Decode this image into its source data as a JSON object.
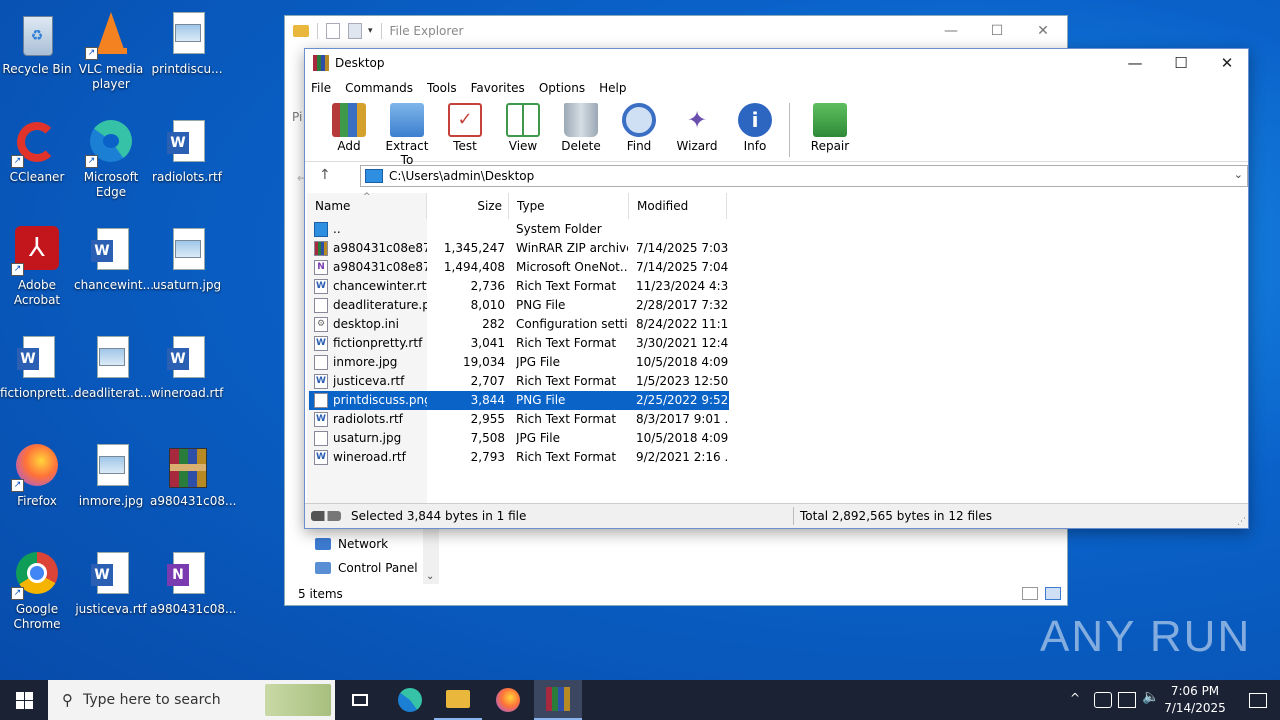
{
  "desktop": {
    "icons": [
      {
        "label": "Recycle Bin"
      },
      {
        "label": "VLC media player"
      },
      {
        "label": "printdiscu..."
      },
      {
        "label": "CCleaner"
      },
      {
        "label": "Microsoft Edge"
      },
      {
        "label": "radiolots.rtf"
      },
      {
        "label": "Adobe Acrobat"
      },
      {
        "label": "chancewint..."
      },
      {
        "label": "usaturn.jpg"
      },
      {
        "label": "fictionprett..."
      },
      {
        "label": "deadliterat..."
      },
      {
        "label": "wineroad.rtf"
      },
      {
        "label": "Firefox"
      },
      {
        "label": "inmore.jpg"
      },
      {
        "label": "a980431c08..."
      },
      {
        "label": "Google Chrome"
      },
      {
        "label": "justiceva.rtf"
      },
      {
        "label": "a980431c08..."
      }
    ]
  },
  "explorer": {
    "title": "File Explorer",
    "side_labels": {
      "pin": "Pi"
    },
    "nav": [
      {
        "label": "Network",
        "color": "#3d7bd1"
      },
      {
        "label": "Control Panel",
        "color": "#5a8fd6"
      }
    ],
    "status": "5 items"
  },
  "rar": {
    "title": "Desktop",
    "menu": [
      "File",
      "Commands",
      "Tools",
      "Favorites",
      "Options",
      "Help"
    ],
    "tools": [
      {
        "label": "Add",
        "icon": "add-archive-icon",
        "color": "#b63a3a"
      },
      {
        "label": "Extract To",
        "icon": "extract-folder-icon",
        "color": "#4a8fd8"
      },
      {
        "label": "Test",
        "icon": "test-checklist-icon",
        "color": "#c7413b"
      },
      {
        "label": "View",
        "icon": "view-book-icon",
        "color": "#3e9a4a"
      },
      {
        "label": "Delete",
        "icon": "trash-icon",
        "color": "#8a9aa8"
      },
      {
        "label": "Find",
        "icon": "magnifier-icon",
        "color": "#3a6fc4"
      },
      {
        "label": "Wizard",
        "icon": "magic-wand-icon",
        "color": "#6a4fae"
      },
      {
        "label": "Info",
        "icon": "info-icon",
        "color": "#2d66c0"
      }
    ],
    "repair": {
      "label": "Repair",
      "icon": "repair-icon",
      "color": "#2e8a38"
    },
    "path": "C:\\Users\\admin\\Desktop",
    "columns": {
      "name": "Name",
      "size": "Size",
      "type": "Type",
      "modified": "Modified"
    },
    "files": [
      {
        "name": "..",
        "size": "",
        "type": "System Folder",
        "modified": ""
      },
      {
        "name": "a980431c08e873...",
        "size": "1,345,247",
        "type": "WinRAR ZIP archive",
        "modified": "7/14/2025 7:03 ..."
      },
      {
        "name": "a980431c08e873...",
        "size": "1,494,408",
        "type": "Microsoft OneNot...",
        "modified": "7/14/2025 7:04 ..."
      },
      {
        "name": "chancewinter.rtf",
        "size": "2,736",
        "type": "Rich Text Format",
        "modified": "11/23/2024 4:3..."
      },
      {
        "name": "deadliterature.p...",
        "size": "8,010",
        "type": "PNG File",
        "modified": "2/28/2017 7:32 ..."
      },
      {
        "name": "desktop.ini",
        "size": "282",
        "type": "Configuration setti...",
        "modified": "8/24/2022 11:1..."
      },
      {
        "name": "fictionpretty.rtf",
        "size": "3,041",
        "type": "Rich Text Format",
        "modified": "3/30/2021 12:4..."
      },
      {
        "name": "inmore.jpg",
        "size": "19,034",
        "type": "JPG File",
        "modified": "10/5/2018 4:09 ..."
      },
      {
        "name": "justiceva.rtf",
        "size": "2,707",
        "type": "Rich Text Format",
        "modified": "1/5/2023 12:50 ..."
      },
      {
        "name": "printdiscuss.png",
        "size": "3,844",
        "type": "PNG File",
        "modified": "2/25/2022 9:52 ..."
      },
      {
        "name": "radiolots.rtf",
        "size": "2,955",
        "type": "Rich Text Format",
        "modified": "8/3/2017 9:01 ..."
      },
      {
        "name": "usaturn.jpg",
        "size": "7,508",
        "type": "JPG File",
        "modified": "10/5/2018 4:09 ..."
      },
      {
        "name": "wineroad.rtf",
        "size": "2,793",
        "type": "Rich Text Format",
        "modified": "9/2/2021 2:16 ..."
      }
    ],
    "status_left": "Selected 3,844 bytes in 1 file",
    "status_right": "Total 2,892,565 bytes in 12 files"
  },
  "taskbar": {
    "search_placeholder": "Type here to search",
    "time": "7:06 PM",
    "date": "7/14/2025"
  },
  "watermark": "ANY RUN"
}
